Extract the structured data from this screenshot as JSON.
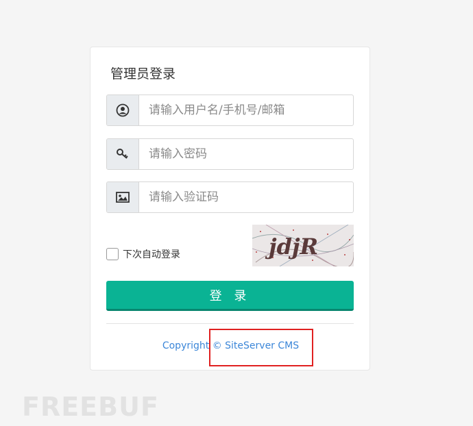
{
  "login": {
    "title": "管理员登录",
    "username_placeholder": "请输入用户名/手机号/邮箱",
    "password_placeholder": "请输入密码",
    "captcha_placeholder": "请输入验证码",
    "remember_label": "下次自动登录",
    "captcha_text": "jdjR",
    "submit_label": "登 录"
  },
  "footer": {
    "copyright_prefix": "Copyright ",
    "copyright_link": "© SiteServer CMS"
  },
  "watermark": "FREEBUF",
  "colors": {
    "accent": "#0ab394",
    "link": "#3b86d8",
    "highlight": "#e02020"
  }
}
